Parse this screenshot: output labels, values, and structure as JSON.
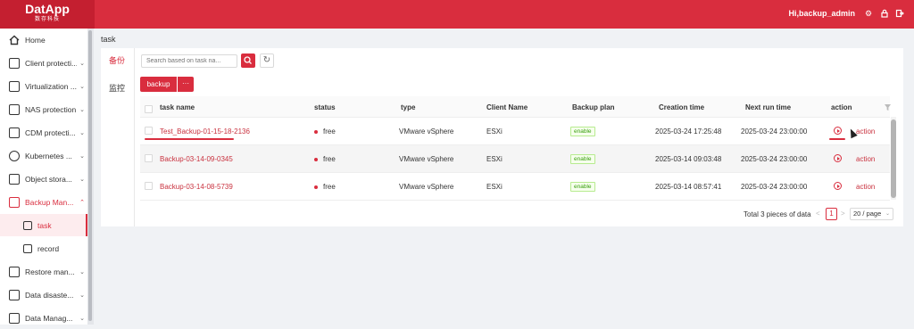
{
  "app": {
    "logo_main": "DatApp",
    "logo_sub": "数存科技",
    "user_greeting": "Hi,backup_admin",
    "icons": [
      "gear-icon",
      "lock-icon",
      "logout-icon"
    ]
  },
  "sidebar": {
    "items": [
      {
        "label": "Home",
        "icon": "home-icon",
        "chevron": ""
      },
      {
        "label": "Client protecti...",
        "icon": "client-icon",
        "chevron": "⌄"
      },
      {
        "label": "Virtualization ...",
        "icon": "virtualization-icon",
        "chevron": "⌄"
      },
      {
        "label": "NAS protection",
        "icon": "nas-icon",
        "chevron": "⌄"
      },
      {
        "label": "CDM protecti...",
        "icon": "cdm-icon",
        "chevron": "⌄"
      },
      {
        "label": "Kubernetes ...",
        "icon": "kubernetes-icon",
        "chevron": "⌄"
      },
      {
        "label": "Object stora...",
        "icon": "object-storage-icon",
        "chevron": "⌄"
      },
      {
        "label": "Backup Man...",
        "icon": "backup-icon",
        "chevron": "⌃"
      },
      {
        "label": "task",
        "icon": "task-icon",
        "chevron": ""
      },
      {
        "label": "record",
        "icon": "record-icon",
        "chevron": ""
      },
      {
        "label": "Restore man...",
        "icon": "restore-icon",
        "chevron": "⌄"
      },
      {
        "label": "Data disaste...",
        "icon": "disaster-icon",
        "chevron": "⌄"
      },
      {
        "label": "Data Manag...",
        "icon": "data-manage-icon",
        "chevron": "⌄"
      }
    ]
  },
  "breadcrumb": "task",
  "tabs": {
    "backup": "备份",
    "monitor": "监控"
  },
  "toolbar": {
    "search_placeholder": "Search based on task na...",
    "backup_label": "backup",
    "more_label": "···"
  },
  "table": {
    "columns": [
      "task name",
      "status",
      "type",
      "Client Name",
      "Backup plan",
      "Creation time",
      "Next run time",
      "action"
    ],
    "rows": [
      {
        "name": "Test_Backup-01-15-18-2136",
        "status": "free",
        "type": "VMware vSphere",
        "client": "ESXi",
        "plan": "enable",
        "created": "2025-03-24 17:25:48",
        "next_run": "2025-03-24 23:00:00",
        "action": "action"
      },
      {
        "name": "Backup-03-14-09-0345",
        "status": "free",
        "type": "VMware vSphere",
        "client": "ESXi",
        "plan": "enable",
        "created": "2025-03-14 09:03:48",
        "next_run": "2025-03-24 23:00:00",
        "action": "action"
      },
      {
        "name": "Backup-03-14-08-5739",
        "status": "free",
        "type": "VMware vSphere",
        "client": "ESXi",
        "plan": "enable",
        "created": "2025-03-14 08:57:41",
        "next_run": "2025-03-24 23:00:00",
        "action": "action"
      }
    ]
  },
  "pagination": {
    "total": "Total 3 pieces of data",
    "current": "1",
    "prev": "<",
    "next": ">",
    "page_size": "20 / page"
  },
  "colors": {
    "brand": "#d92d3e",
    "enable_tag": "#389e0d"
  }
}
